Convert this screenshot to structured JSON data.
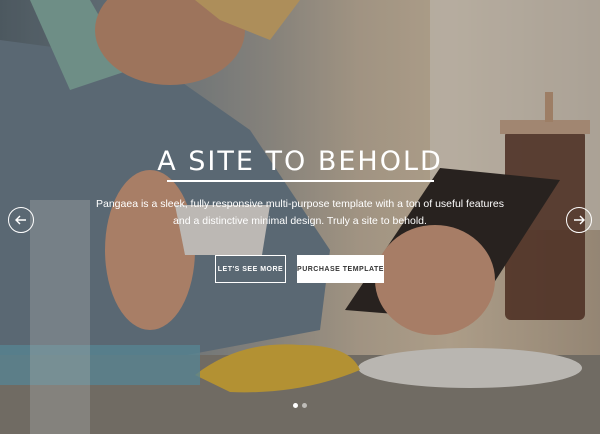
{
  "hero": {
    "title": "A SITE TO BEHOLD",
    "description": "Pangaea is a sleek, fully responsive multi-purpose template with a ton of useful features and a distinctive minimal design. Truly a site to behold.",
    "primary_button": "LET'S SEE MORE",
    "secondary_button": "PURCHASE TEMPLATE",
    "prev_icon": "arrow-left-icon",
    "next_icon": "arrow-right-icon",
    "slide_count": 2,
    "active_slide": 1
  },
  "colors": {
    "text": "#ffffff",
    "solid_button_bg": "#ffffff",
    "solid_button_text": "#333333"
  }
}
